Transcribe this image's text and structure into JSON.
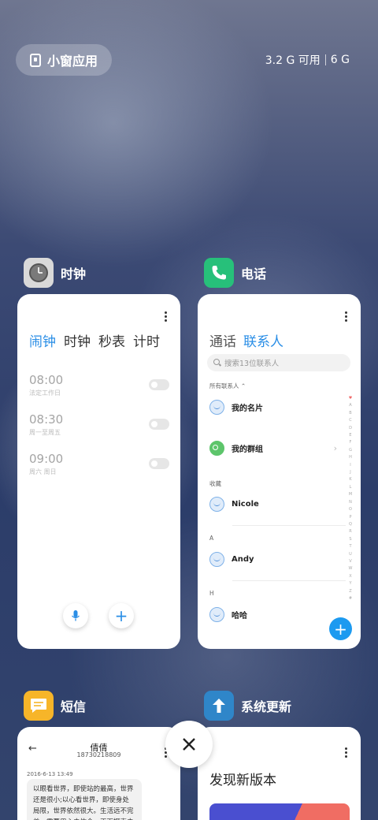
{
  "topbar": {
    "small_window_label": "小窗应用",
    "memory_available": "3.2 G 可用",
    "memory_total": "6 G"
  },
  "apps": {
    "clock": {
      "name": "时钟",
      "icon": "clock-icon",
      "tabs": [
        "闹钟",
        "时钟",
        "秒表",
        "计时"
      ],
      "active_tab": 0,
      "alarms": [
        {
          "time": "08:00",
          "sub": "法定工作日"
        },
        {
          "time": "08:30",
          "sub": "周一至周五"
        },
        {
          "time": "09:00",
          "sub": "周六 周日"
        }
      ]
    },
    "phone": {
      "name": "电话",
      "icon": "phone-icon",
      "tabs": [
        "通话",
        "联系人"
      ],
      "active_tab": 1,
      "search_placeholder": "搜索13位联系人",
      "all_contacts_label": "所有联系人 ⌃",
      "my_card": "我的名片",
      "my_groups": "我的群组",
      "favorites_label": "收藏",
      "contacts": [
        {
          "section": "",
          "name": "Nicole"
        },
        {
          "section": "A",
          "name": "Andy"
        },
        {
          "section": "H",
          "name": "哈哈"
        }
      ],
      "alphabet": [
        "♥",
        "A",
        "B",
        "C",
        "D",
        "E",
        "F",
        "G",
        "H",
        "I",
        "J",
        "K",
        "L",
        "M",
        "N",
        "O",
        "P",
        "Q",
        "R",
        "S",
        "T",
        "U",
        "V",
        "W",
        "X",
        "Y",
        "Z",
        "#"
      ]
    },
    "sms": {
      "name": "短信",
      "icon": "message-icon",
      "contact_name": "倩倩",
      "contact_number": "18730218809",
      "date": "2016-6-13 13:49",
      "message": "以眼看世界，即使站的最高，世界还是很小;以心看世界，即使身处局限，世界依然很大。生活远不完美，需要用心去体会，正面探索去"
    },
    "update": {
      "name": "系统更新",
      "icon": "arrow-up-icon",
      "title": "发现新版本"
    }
  },
  "colors": {
    "accent": "#2a8ee6",
    "clock_icon_bg": "#d4d4d4",
    "phone_icon_bg": "#27c07a",
    "sms_icon_bg": "#f7b529",
    "update_icon_bg": "#2f86c9"
  }
}
